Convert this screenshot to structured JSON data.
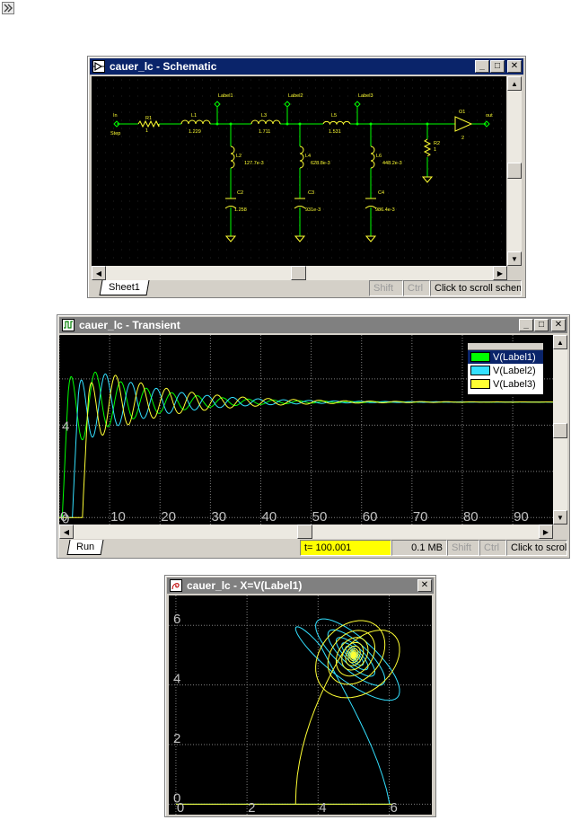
{
  "colors": {
    "green": "#00ff00",
    "cyan": "#33e0ff",
    "yellow": "#ffff33",
    "wire": "#00ff00",
    "part": "#ffff33",
    "grid": "#808080",
    "title_active": "#0a246a",
    "title_inactive": "#808080",
    "time_bg": "#ffff00"
  },
  "schematic": {
    "title": "cauer_lc - Schematic",
    "labels": {
      "in": "In",
      "step": "Step",
      "r1": "R1",
      "r1v": "1",
      "l1": "L1",
      "l1v": "1.229",
      "l3": "L3",
      "l3v": "1.711",
      "l5": "L5",
      "l5v": "1.531",
      "label1": "Label1",
      "label2": "Label2",
      "label3": "Label3",
      "l2": "L2",
      "l2v": "127.7e-3",
      "l4": "L4",
      "l4v": "628.8e-3",
      "l6": "L6",
      "l6v": "448.2e-3",
      "c2": "C2",
      "c2v": "1.258",
      "c3": "C3",
      "c3v": "931e-3",
      "c4": "C4",
      "c4v": "986.4e-3",
      "r2": "R2",
      "r2v": "1",
      "o1": "O1",
      "o1v": "2",
      "out": "out"
    },
    "tab": "Sheet1",
    "shift": "Shift",
    "ctrl": "Ctrl",
    "hint": "Click to scroll schem"
  },
  "transient": {
    "title": "cauer_lc - Transient",
    "tab": "Run",
    "time": "t= 100.001",
    "memory": "0.1 MB",
    "shift": "Shift",
    "ctrl": "Ctrl",
    "hint": "Click to scroll",
    "legend": [
      "V(Label1)",
      "V(Label2)",
      "V(Label3)"
    ]
  },
  "xy": {
    "title": "cauer_lc - X=V(Label1)"
  },
  "chart_data": [
    {
      "type": "line",
      "x_ticks": [
        0,
        10,
        20,
        30,
        40,
        50,
        60,
        70,
        80,
        90
      ],
      "y_ticks": [
        0,
        4
      ],
      "xlim": [
        0,
        98
      ],
      "ylim": [
        -0.3,
        7.9
      ],
      "series": [
        {
          "name": "V(Label1)",
          "color": "green",
          "steady": 5,
          "amp": 2.15,
          "delay": 0.6,
          "period": 5.05,
          "decay": 13
        },
        {
          "name": "V(Label2)",
          "color": "cyan",
          "steady": 5,
          "amp": 1.95,
          "delay": 2.6,
          "period": 5.05,
          "decay": 14
        },
        {
          "name": "V(Label3)",
          "color": "yellow",
          "steady": 5,
          "amp": 1.8,
          "delay": 4.6,
          "period": 5.05,
          "decay": 15
        }
      ]
    },
    {
      "type": "line",
      "x_ticks": [
        0,
        2,
        4,
        6
      ],
      "y_ticks": [
        0,
        2,
        4,
        6
      ],
      "xlim": [
        -0.2,
        7.2
      ],
      "ylim": [
        -0.35,
        7.0
      ]
    }
  ]
}
